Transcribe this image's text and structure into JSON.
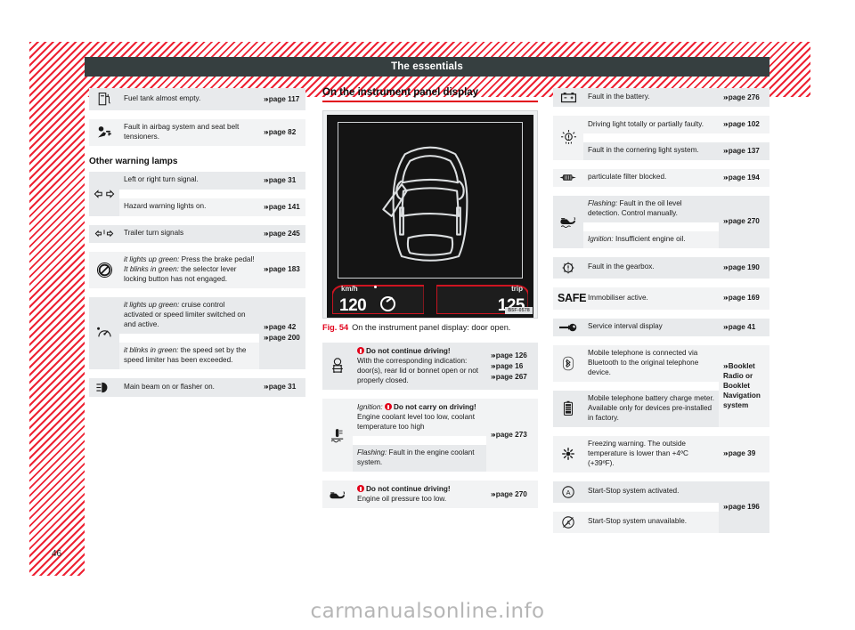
{
  "page": {
    "header_title": "The essentials",
    "page_number": "46",
    "watermark": "carmanualsonline.info"
  },
  "left_column": {
    "top_table": {
      "rows": [
        {
          "icon": "fuel-pump-icon",
          "text": "Fuel tank almost empty.",
          "ref": "page 117"
        },
        {
          "icon": "airbag-seatbelt-icon",
          "text": "Fault in airbag system and seat belt tensioners.",
          "ref": "page 82"
        }
      ]
    },
    "section_heading": "Other warning lamps",
    "other_table": {
      "rows": [
        {
          "icon": "turn-signal-arrows-icon",
          "text": "Left or right turn signal.",
          "ref": "page 31"
        },
        {
          "icon": "turn-signal-arrows-icon",
          "text": "Hazard warning lights on.",
          "ref": "page 141"
        },
        {
          "icon": "trailer-turn-signal-icon",
          "text": "Trailer turn signals",
          "ref": "page 245"
        },
        {
          "icon": "brake-pedal-selector-icon",
          "text_parts": [
            {
              "style": "italic",
              "text": "it lights up green:"
            },
            {
              "style": "normal",
              "text": " Press the brake pedal!"
            },
            {
              "style": "break"
            },
            {
              "style": "italic",
              "text": "It blinks in green:"
            },
            {
              "style": "normal",
              "text": " the selector lever locking button has not engaged."
            }
          ],
          "ref": "page 183"
        },
        {
          "icon": "cruise-control-icon",
          "text_parts": [
            {
              "style": "italic",
              "text": "it lights up green:"
            },
            {
              "style": "normal",
              "text": " cruise control activated or speed limiter switched on and active."
            }
          ],
          "ref": "page 42",
          "ref2": "page 200"
        },
        {
          "icon": "cruise-control-icon",
          "text_parts": [
            {
              "style": "italic",
              "text": "it blinks in green:"
            },
            {
              "style": "normal",
              "text": " the speed set by the speed limiter has been exceeded."
            }
          ],
          "ref": ""
        },
        {
          "icon": "main-beam-icon",
          "text": "Main beam on or flasher on.",
          "ref": "page 31"
        }
      ]
    }
  },
  "mid_column": {
    "title": "On the instrument panel display",
    "figure": {
      "speed_label": "km/h",
      "speed_value": "120",
      "trip_label": "trip",
      "trip_value": "125",
      "code": "B5F-0578",
      "caption_label": "Fig. 54",
      "caption_text": "On the instrument panel display: door open."
    },
    "table": {
      "rows": [
        {
          "icon": "door-open-icon",
          "text_parts": [
            {
              "style": "warn-bold",
              "text": "Do not continue driving!"
            },
            {
              "style": "break"
            },
            {
              "style": "normal",
              "text": "With the corresponding indication: door(s), rear lid or bonnet open or not properly closed."
            }
          ],
          "refs": [
            "page 126",
            "page 16",
            "page 267"
          ]
        },
        {
          "icon": "coolant-temp-icon",
          "text_parts": [
            {
              "style": "italic",
              "text": "Ignition:"
            },
            {
              "style": "warn-bold-inline",
              "text": "Do not carry on driving!"
            },
            {
              "style": "normal",
              "text": " Engine coolant level too low, coolant temperature too high"
            }
          ],
          "refs": [
            "page 273"
          ]
        },
        {
          "icon": "coolant-temp-icon",
          "text_parts": [
            {
              "style": "italic",
              "text": "Flashing:"
            },
            {
              "style": "normal",
              "text": " Fault in the engine coolant system."
            }
          ],
          "refs": []
        },
        {
          "icon": "oil-pressure-icon",
          "text_parts": [
            {
              "style": "warn-bold",
              "text": "Do not continue driving!"
            },
            {
              "style": "break"
            },
            {
              "style": "normal",
              "text": "Engine oil pressure too low."
            }
          ],
          "refs": [
            "page 270"
          ]
        }
      ]
    }
  },
  "right_column": {
    "table": {
      "rows": [
        {
          "icon": "battery-icon",
          "text": "Fault in the battery.",
          "ref": "page 276"
        },
        {
          "icon": "bulb-fault-icon",
          "text": "Driving light totally or partially faulty.",
          "ref": "page 102"
        },
        {
          "icon": "bulb-fault-icon",
          "text": "Fault in the cornering light system.",
          "ref": "page 137"
        },
        {
          "icon": "particulate-filter-icon",
          "text": "particulate filter blocked.",
          "ref": "page 194"
        },
        {
          "icon": "oil-level-icon",
          "text_parts": [
            {
              "style": "italic",
              "text": "Flashing:"
            },
            {
              "style": "normal",
              "text": " Fault in the oil level detection. Control manually."
            }
          ],
          "ref": "page 270"
        },
        {
          "icon": "oil-level-icon",
          "text_parts": [
            {
              "style": "italic",
              "text": "Ignition:"
            },
            {
              "style": "normal",
              "text": " Insufficient engine oil."
            }
          ],
          "ref": ""
        },
        {
          "icon": "gearbox-fault-icon",
          "text": "Fault in the gearbox.",
          "ref": "page 190"
        },
        {
          "icon": "safe-immobiliser-icon",
          "text": "Immobiliser active.",
          "ref": "page 169"
        },
        {
          "icon": "spanner-service-icon",
          "text": "Service interval display",
          "ref": "page 41"
        },
        {
          "icon": "bluetooth-icon",
          "text": "Mobile telephone is connected via Bluetooth to the original telephone device.",
          "ref": "Booklet Radio or",
          "ref2": "Booklet Navigation system"
        },
        {
          "icon": "phone-battery-icon",
          "text": "Mobile telephone battery charge meter. Available only for devices pre-installed in factory.",
          "ref": ""
        },
        {
          "icon": "frost-warning-icon",
          "text": "Freezing warning. The outside temperature is lower than +4ºC (+39ºF).",
          "ref": "page 39"
        },
        {
          "icon": "start-stop-active-icon",
          "text": "Start-Stop system activated.",
          "ref": "page 196"
        },
        {
          "icon": "start-stop-unavailable-icon",
          "text": "Start-Stop system unavailable.",
          "ref": ""
        }
      ]
    }
  }
}
